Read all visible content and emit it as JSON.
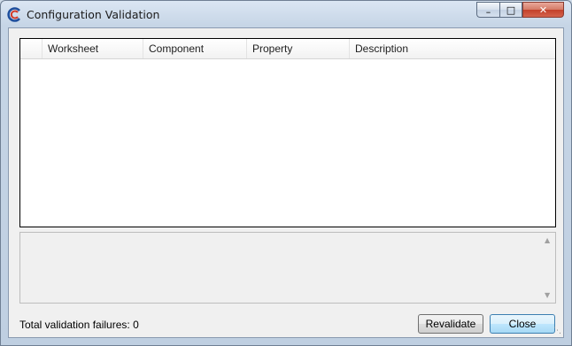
{
  "window": {
    "title": "Configuration Validation",
    "controls": {
      "minimize": "–",
      "maximize": "□",
      "close": "✕"
    }
  },
  "grid": {
    "columns": [
      "Worksheet",
      "Component",
      "Property",
      "Description"
    ],
    "rows": []
  },
  "details": {
    "text": ""
  },
  "status": {
    "text": "Total validation failures: 0"
  },
  "buttons": {
    "revalidate": "Revalidate",
    "close": "Close"
  },
  "colors": {
    "accent": "#3c7fb1",
    "close_control": "#c3402a"
  },
  "icons": {
    "app": "app-logo-icon",
    "scroll_up": "scroll-up-icon",
    "scroll_down": "scroll-down-icon",
    "grip": "resize-grip-icon"
  }
}
